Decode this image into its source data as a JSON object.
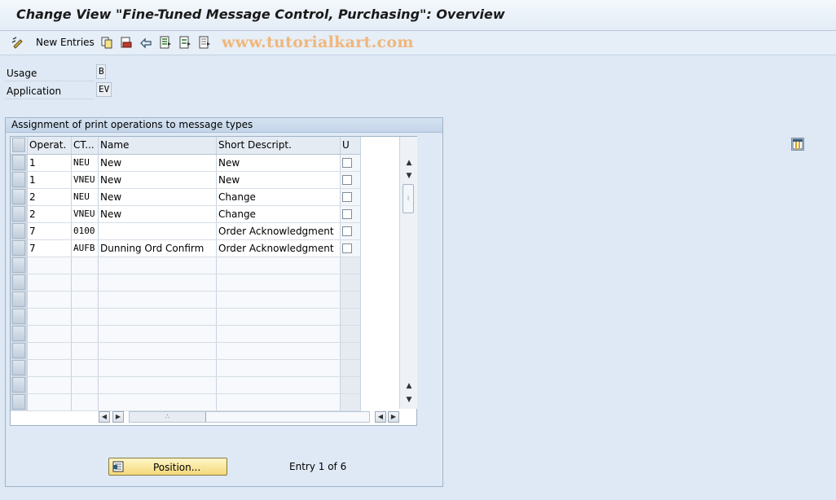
{
  "window": {
    "title": "Change View \"Fine-Tuned Message Control, Purchasing\": Overview"
  },
  "toolbar": {
    "new_entries_label": "New Entries",
    "watermark": "www.tutorialkart.com",
    "icons": [
      "display-change-icon",
      "copy-icon",
      "delete-icon",
      "undo-icon",
      "select-all-icon",
      "select-block-icon",
      "deselect-all-icon"
    ]
  },
  "fields": {
    "usage": {
      "label": "Usage",
      "value": "B"
    },
    "application": {
      "label": "Application",
      "value": "EV"
    }
  },
  "group": {
    "title": "Assignment of print operations to message types"
  },
  "table": {
    "columns": [
      "Operat.",
      "CT...",
      "Name",
      "Short Descript.",
      "U"
    ],
    "rows": [
      {
        "operat": "1",
        "ct": "NEU",
        "name": "New",
        "short": "New",
        "u": false
      },
      {
        "operat": "1",
        "ct": "VNEU",
        "name": "New",
        "short": "New",
        "u": false
      },
      {
        "operat": "2",
        "ct": "NEU",
        "name": "New",
        "short": "Change",
        "u": false
      },
      {
        "operat": "2",
        "ct": "VNEU",
        "name": "New",
        "short": "Change",
        "u": false
      },
      {
        "operat": "7",
        "ct": "0100",
        "name": "",
        "short": "Order Acknowledgment",
        "u": false
      },
      {
        "operat": "7",
        "ct": "AUFB",
        "name": "Dunning Ord Confirm",
        "short": "Order Acknowledgment",
        "u": false
      }
    ]
  },
  "footer": {
    "position_button": "Position...",
    "entry_info": "Entry 1 of 6"
  },
  "colors": {
    "background": "#dfe9f5",
    "position_button": "#f3d97a",
    "watermark": "#f0b77a"
  }
}
